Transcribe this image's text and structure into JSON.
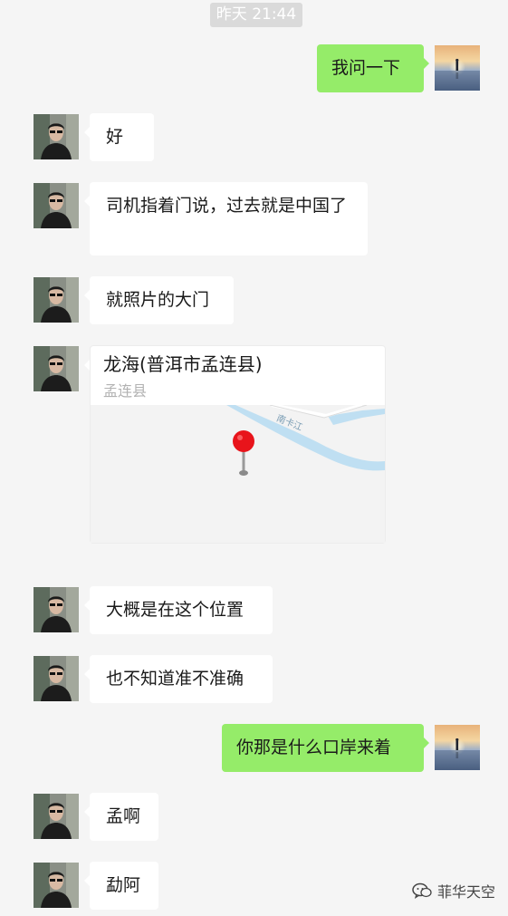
{
  "timestamp": "昨天 21:44",
  "messages": {
    "m1": "我问一下",
    "m2": "好",
    "m3": "司机指着门说，过去就是中国了",
    "m4": "就照片的大门",
    "m6": "大概是在这个位置",
    "m7": "也不知道准不准确",
    "m8": "你那是什么口岸来着",
    "m9": "孟啊",
    "m10": "勐阿"
  },
  "location": {
    "title": "龙海(普洱市孟连县)",
    "subtitle": "孟连县",
    "river_label": "南卡江"
  },
  "watermark": "菲华天空",
  "colors": {
    "background": "#f5f5f5",
    "outgoing_bubble": "#95ec69",
    "incoming_bubble": "#ffffff",
    "timestamp_bg": "#dadada",
    "map_river": "#bfdff2",
    "pin": "#e8141b"
  }
}
